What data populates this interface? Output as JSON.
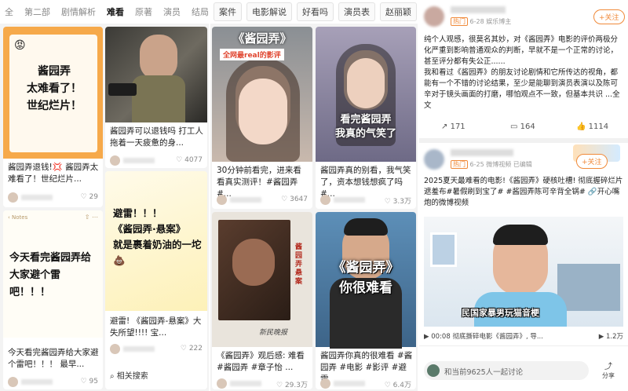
{
  "panel1": {
    "tabs": [
      "全",
      "第二部",
      "剧情解析",
      "难看",
      "原著",
      "演员",
      "结局"
    ],
    "active_tab": "难看",
    "card1": {
      "headline": "酱园弄\n太难看了！\n世纪烂片！",
      "caption": "酱园弄退钱!💢 酱园弄太难看了！世纪烂片...",
      "likes": "29"
    },
    "card2": {
      "caption": "酱园弄可以退钱吗 打工人拖着一天疲惫的身...",
      "likes": "4077"
    },
    "card3": {
      "headline": "今天看完酱园弄给大家避个雷吧！！！",
      "caption": "今天看完酱园弄给大家避个雷吧！！！ 最早...",
      "likes": "95"
    },
    "card4": {
      "headline": "避雷！！！\n《酱园弄·悬案》\n就是裹着奶油的一坨💩",
      "caption": "避雷! 《酱园弄-悬案》大失所望!!!! 宝...",
      "likes": "222",
      "related": "相关搜索"
    }
  },
  "panel2": {
    "tabs": [
      "案件",
      "电影解说",
      "好看吗",
      "演员表",
      "赵丽颖"
    ],
    "card1": {
      "overlay_title": "《酱园弄》",
      "overlay_sub": "全网最real的影评",
      "caption": "30分钟前看完，进来看看真实测评！#酱园弄 #...",
      "likes": "3647"
    },
    "card2": {
      "overlay": "看完酱园弄\n我真的气笑了",
      "caption": "酱园弄真的别看，我气笑了，资本想钱想疯了吗 #...",
      "likes": "3.3万"
    },
    "card3": {
      "poster_text": "酱园弄 悬案",
      "sign": "新民晚报",
      "caption": "《酱园弄》观后感: 难看 #酱园弄 #章子怡 ...",
      "likes": "29.3万"
    },
    "card4": {
      "overlay": "《酱园弄》\n你很难看",
      "caption": "酱园弄你真的很难看 #酱园弄 #电影 #影评 #避雷",
      "likes": "6.4万"
    }
  },
  "panel3": {
    "post1": {
      "date": "6-28",
      "source": "娱乐博主",
      "follow": "+关注",
      "tag": "热门",
      "body": "纯个人观感，很莫名其妙，对《酱园弄》电影的评价两极分化严重到影响普通观众的判断，早就不是一个正常的讨论，甚至评分都有失公正......\n我和看过《酱园弄》的朋友讨论剧情和它所传达的视角，都能有一个不错的讨论结果，至少是能聊到演员表演以及陈可辛对于镜头画面的打磨，哪怕观点不一致，但基本共识 ...全文",
      "reposts": "171",
      "comments": "164",
      "likes": "1114"
    },
    "post2": {
      "date": "6-25",
      "source": "微博视频",
      "edited": "已编辑",
      "follow": "+关注",
      "tag": "热门",
      "body": "2025夏天最难看的电影!《酱园弄》硬核吐槽! 彻底握碎烂片遮羞布#暑假刷到宝了# #酱园弄陈可辛背全锅# 🔗开心嘴炮的微博视频",
      "video_sub": "民国家暴男玩猫音梗",
      "video_title": "00:08 彻底撕碎电影《酱园弄》, 导...",
      "views": "1.2万",
      "input_placeholder": "和当前9625人一起讨论",
      "share": "分享"
    }
  },
  "colors": {
    "accent": "#f08a3a",
    "orange_card": "#f6a94a",
    "weibo_blue": "#1a6fc4"
  }
}
